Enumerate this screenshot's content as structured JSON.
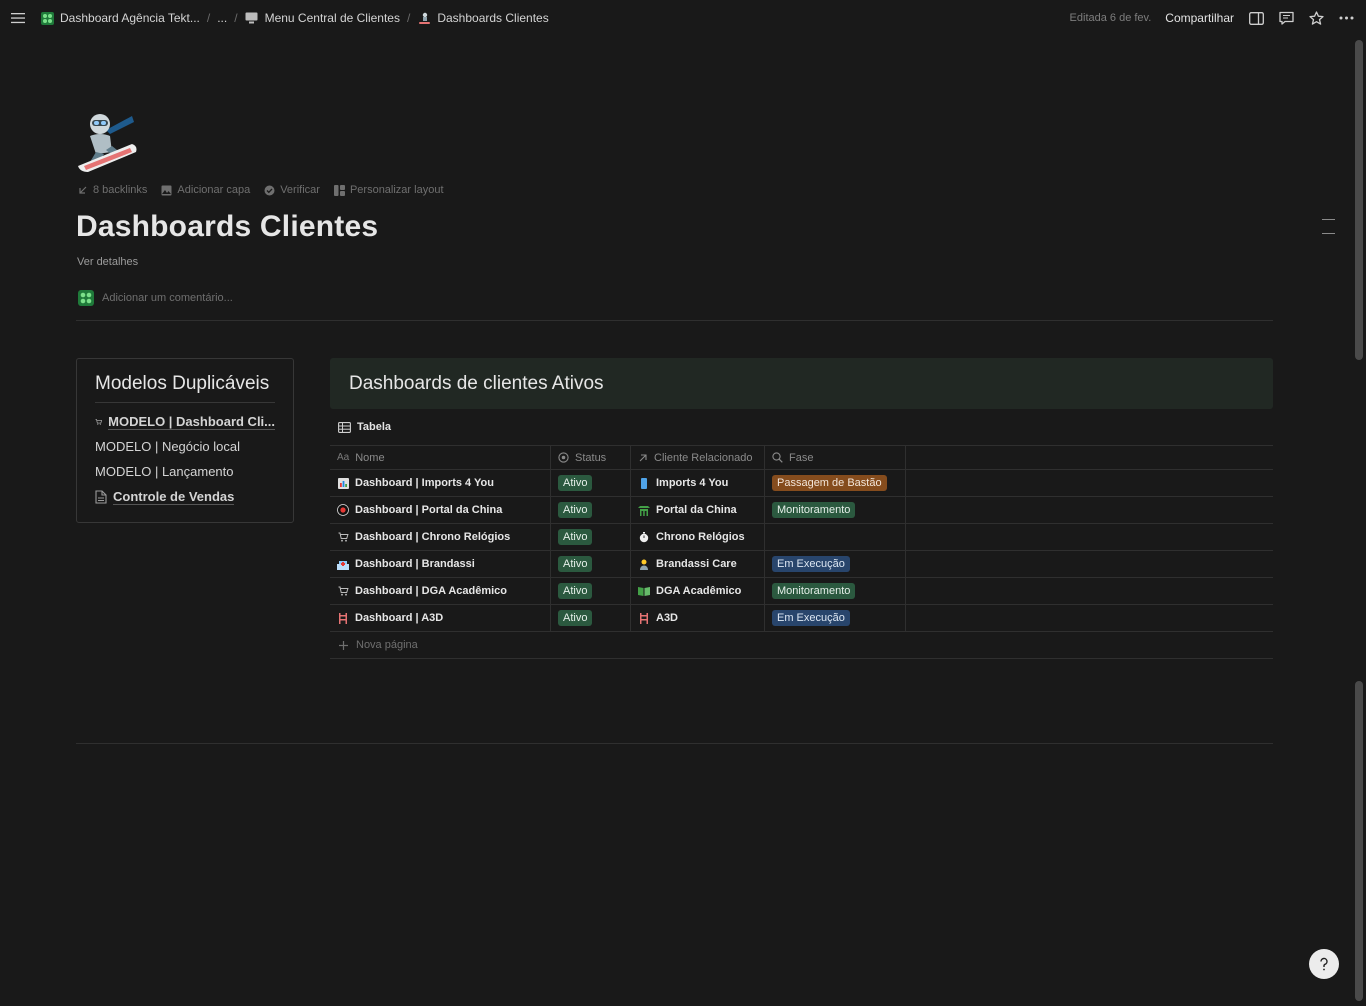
{
  "topbar": {
    "breadcrumbs": [
      {
        "label": "Dashboard Agência Tekt...",
        "icon": "workspace-logo-icon"
      },
      {
        "label": "..."
      },
      {
        "label": "Menu Central de Clientes",
        "icon": "monitor-icon"
      },
      {
        "label": "Dashboards Clientes",
        "icon": "snowboarder-icon"
      }
    ],
    "separator": "/",
    "edited": "Editada 6 de fev.",
    "share": "Compartilhar"
  },
  "page": {
    "title": "Dashboards Clientes",
    "see_details": "Ver detalhes",
    "actions": {
      "backlinks": "8 backlinks",
      "add_cover": "Adicionar capa",
      "verify": "Verificar",
      "customize": "Personalizar layout"
    },
    "comment_placeholder": "Adicionar um comentário..."
  },
  "models": {
    "title": "Modelos Duplicáveis",
    "items": [
      {
        "label": "MODELO | Dashboard Cli...",
        "icon": "cart-icon",
        "link": true
      },
      {
        "label": "MODELO | Negócio local",
        "link": false
      },
      {
        "label": "MODELO | Lançamento",
        "link": false
      },
      {
        "label": "Controle de Vendas",
        "icon": "document-icon",
        "link": true
      }
    ]
  },
  "database": {
    "title": "Dashboards de clientes Ativos",
    "view_tab": "Tabela",
    "columns": {
      "name": "Nome",
      "name_prefix": "Aa",
      "status": "Status",
      "client": "Cliente Relacionado",
      "phase": "Fase"
    },
    "rows": [
      {
        "name": "Dashboard | Imports 4 You",
        "status": "Ativo",
        "client": "Imports 4 You",
        "phase": "Passagem de Bastão",
        "phase_color": "orange"
      },
      {
        "name": "Dashboard | Portal da China",
        "status": "Ativo",
        "client": "Portal da China",
        "phase": "Monitoramento",
        "phase_color": "green"
      },
      {
        "name": "Dashboard | Chrono Relógios",
        "status": "Ativo",
        "client": "Chrono Relógios",
        "phase": "",
        "phase_color": ""
      },
      {
        "name": "Dashboard | Brandassi",
        "status": "Ativo",
        "client": "Brandassi Care",
        "phase": "Em Execução",
        "phase_color": "blue"
      },
      {
        "name": "Dashboard | DGA Acadêmico",
        "status": "Ativo",
        "client": "DGA Acadêmico",
        "phase": "Monitoramento",
        "phase_color": "green"
      },
      {
        "name": "Dashboard | A3D",
        "status": "Ativo",
        "client": "A3D",
        "phase": "Em Execução",
        "phase_color": "blue"
      }
    ],
    "new_page": "Nova página"
  },
  "colors": {
    "background": "#191919",
    "tag_green": "#2b593f",
    "tag_orange": "#854c1d",
    "tag_blue": "#28456c",
    "db_header_bg": "#212823"
  }
}
